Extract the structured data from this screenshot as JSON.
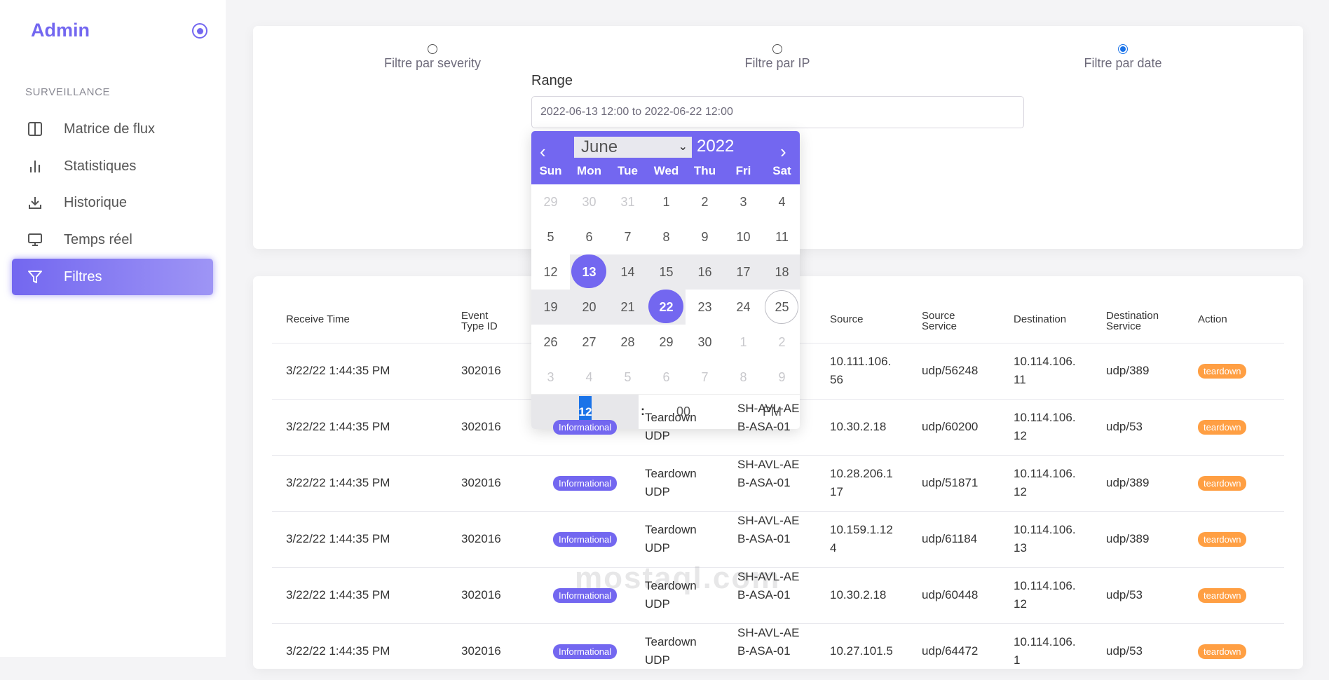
{
  "brand": {
    "title": "Admin",
    "icon": "target-circle-icon"
  },
  "sidebar": {
    "section": "SURVEILLANCE",
    "items": [
      {
        "label": "Matrice de flux",
        "icon": "columns-icon",
        "active": false
      },
      {
        "label": "Statistiques",
        "icon": "bar-chart-icon",
        "active": false
      },
      {
        "label": "Historique",
        "icon": "download-icon",
        "active": false
      },
      {
        "label": "Temps réel",
        "icon": "monitor-icon",
        "active": false
      },
      {
        "label": "Filtres",
        "icon": "filter-icon",
        "active": true
      }
    ]
  },
  "filters": {
    "options": [
      {
        "label": "Filtre par severity",
        "checked": false
      },
      {
        "label": "Filtre par IP",
        "checked": false
      },
      {
        "label": "Filtre par date",
        "checked": true
      }
    ],
    "range_label": "Range",
    "range_value": "2022-06-13 12:00 to 2022-06-22 12:00"
  },
  "calendar": {
    "month": "June",
    "year": "2022",
    "weekdays": [
      "Sun",
      "Mon",
      "Tue",
      "Wed",
      "Thu",
      "Fri",
      "Sat"
    ],
    "weeks": [
      [
        "29",
        "30",
        "31",
        "1",
        "2",
        "3",
        "4"
      ],
      [
        "5",
        "6",
        "7",
        "8",
        "9",
        "10",
        "11"
      ],
      [
        "12",
        "13",
        "14",
        "15",
        "16",
        "17",
        "18"
      ],
      [
        "19",
        "20",
        "21",
        "22",
        "23",
        "24",
        "25"
      ],
      [
        "26",
        "27",
        "28",
        "29",
        "30",
        "1",
        "2"
      ],
      [
        "3",
        "4",
        "5",
        "6",
        "7",
        "8",
        "9"
      ]
    ],
    "range_start": "13",
    "range_end": "22",
    "today": "25",
    "time": {
      "hour": "12",
      "separator": ":",
      "minute": "00",
      "ampm": "PM"
    }
  },
  "table": {
    "headers": [
      "Receive Time",
      "Event Type ID",
      "Source",
      "Source Service",
      "Destination",
      "Destination Service",
      "Action"
    ],
    "rows": [
      {
        "time": "3/22/22 1:44:35 PM",
        "event": "302016",
        "severity": "",
        "message": "",
        "device": "",
        "source": "10.111.106.56",
        "source_service": "udp/56248",
        "destination": "10.114.106.11",
        "dest_service": "udp/389",
        "action": "teardown"
      },
      {
        "time": "3/22/22 1:44:35 PM",
        "event": "302016",
        "severity": "Informational",
        "message": "Teardown UDP",
        "device": "SH-AVL-AEB-ASA-01",
        "source": "10.30.2.18",
        "source_service": "udp/60200",
        "destination": "10.114.106.12",
        "dest_service": "udp/53",
        "action": "teardown"
      },
      {
        "time": "3/22/22 1:44:35 PM",
        "event": "302016",
        "severity": "Informational",
        "message": "Teardown UDP",
        "device": "SH-AVL-AEB-ASA-01",
        "source": "10.28.206.117",
        "source_service": "udp/51871",
        "destination": "10.114.106.12",
        "dest_service": "udp/389",
        "action": "teardown"
      },
      {
        "time": "3/22/22 1:44:35 PM",
        "event": "302016",
        "severity": "Informational",
        "message": "Teardown UDP",
        "device": "SH-AVL-AEB-ASA-01",
        "source": "10.159.1.124",
        "source_service": "udp/61184",
        "destination": "10.114.106.13",
        "dest_service": "udp/389",
        "action": "teardown"
      },
      {
        "time": "3/22/22 1:44:35 PM",
        "event": "302016",
        "severity": "Informational",
        "message": "Teardown UDP",
        "device": "SH-AVL-AEB-ASA-01",
        "source": "10.30.2.18",
        "source_service": "udp/60448",
        "destination": "10.114.106.12",
        "dest_service": "udp/53",
        "action": "teardown"
      },
      {
        "time": "3/22/22 1:44:35 PM",
        "event": "302016",
        "severity": "Informational",
        "message": "Teardown UDP",
        "device": "SH-AVL-AEB-ASA-01",
        "source": "10.27.101.5",
        "source_service": "udp/64472",
        "destination": "10.114.106.1",
        "dest_service": "udp/53",
        "action": "teardown"
      }
    ]
  },
  "watermark": "mostaql.com",
  "colors": {
    "accent": "#7367f0",
    "orange": "#ff9f43",
    "blue": "#1a73e8"
  }
}
